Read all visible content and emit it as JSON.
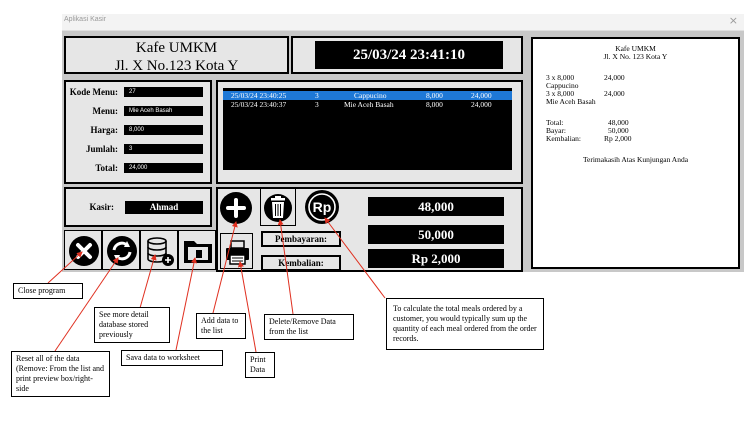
{
  "window": {
    "title": "Aplikasi Kasir",
    "close_glyph": "×"
  },
  "header": {
    "shop_name": "Kafe UMKM",
    "address": "Jl. X No.123 Kota Y",
    "datetime": "25/03/24  23:41:10"
  },
  "form": {
    "kode_label": "Kode Menu:",
    "kode_value": "27",
    "menu_label": "Menu:",
    "menu_value": "Mie Aceh Basah",
    "harga_label": "Harga:",
    "harga_value": "8,000",
    "jumlah_label": "Jumlah:",
    "jumlah_value": "3",
    "total_label": "Total:",
    "total_value": "24,000"
  },
  "orders": [
    {
      "time": "25/03/24  23:40:25",
      "qty": "3",
      "menu": "Cappucino",
      "price": "8,000",
      "total": "24,000",
      "selected": true
    },
    {
      "time": "25/03/24  23:40:37",
      "qty": "3",
      "menu": "Mie Aceh Basah",
      "price": "8,000",
      "total": "24,000",
      "selected": false
    }
  ],
  "kasir": {
    "label": "Kasir:",
    "value": "Ahmad"
  },
  "payment": {
    "total": "48,000",
    "pembayaran_label": "Pembayaran:",
    "pembayaran_value": "50,000",
    "kembalian_label": "Kembalian:",
    "kembalian_value": "Rp 2,000"
  },
  "receipt": {
    "shop_name": "Kafe UMKM",
    "address": "Jl. X No. 123 Kota Y",
    "item1_line": "3 x 8,000",
    "item1_total": "24,000",
    "item1_name": "Cappucino",
    "item2_line": "3 x 8,000",
    "item2_total": "24,000",
    "item2_name": "Mie Aceh Basah",
    "total_label": "Total:",
    "total_value": "48,000",
    "bayar_label": "Bayar:",
    "bayar_value": "50,000",
    "kembalian_label": "Kembalian:",
    "kembalian_value": "Rp 2,000",
    "thanks": "Terimakasih Atas Kunjungan Anda"
  },
  "buttons": {
    "rp_glyph": "Rp"
  },
  "annotations": {
    "close": "Close program",
    "reset": "Reset all of the data (Remove: From the list and print preview box/right-side",
    "detail": "See more detail database stored previously",
    "save": "Sava data to worksheet",
    "add": "Add data to the list",
    "print": "Print Data",
    "delete": "Delete/Remove Data from the list",
    "calc": "To calculate the total meals ordered by a customer, you would typically sum up the quantity of each meal ordered from the order records."
  }
}
